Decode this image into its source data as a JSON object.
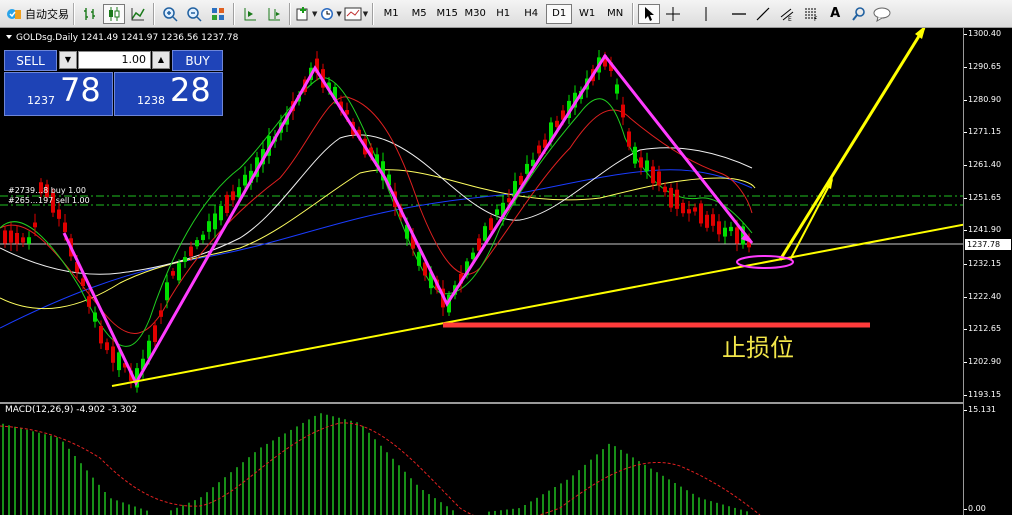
{
  "toolbar": {
    "auto_trading_label": "自动交易",
    "timeframes": [
      "M1",
      "M5",
      "M15",
      "M30",
      "H1",
      "H4",
      "D1",
      "W1",
      "MN"
    ],
    "active_timeframe": "D1",
    "text_tool_label": "A"
  },
  "chart": {
    "symbol_info": "GOLDsg.Daily  1241.49 1241.97 1236.56 1237.78",
    "current_price": "1237.78",
    "price_labels": [
      "1300.40",
      "1290.65",
      "1280.90",
      "1271.15",
      "1261.40",
      "1251.65",
      "1241.90",
      "1232.15",
      "1222.40",
      "1212.65",
      "1202.90",
      "1193.15"
    ],
    "order_labels": [
      "#2739…8 buy 1.00",
      "#265…197 sell 1.00"
    ],
    "annotation_stop": "止损位",
    "macd_label": "MACD(12,26,9) -4.902 -3.302",
    "macd_scale": [
      "15.131",
      "0.00"
    ]
  },
  "trade_panel": {
    "sell_label": "SELL",
    "buy_label": "BUY",
    "lot": "1.00",
    "bid_small": "1237",
    "bid_big": "78",
    "ask_small": "1238",
    "ask_big": "28"
  },
  "colors": {
    "bull": "#00e000",
    "bear": "#e00000",
    "trend": "#ffff00",
    "zigzag": "#ff3cff",
    "stop": "#ff3b3b",
    "panel": "#1e43b6"
  }
}
